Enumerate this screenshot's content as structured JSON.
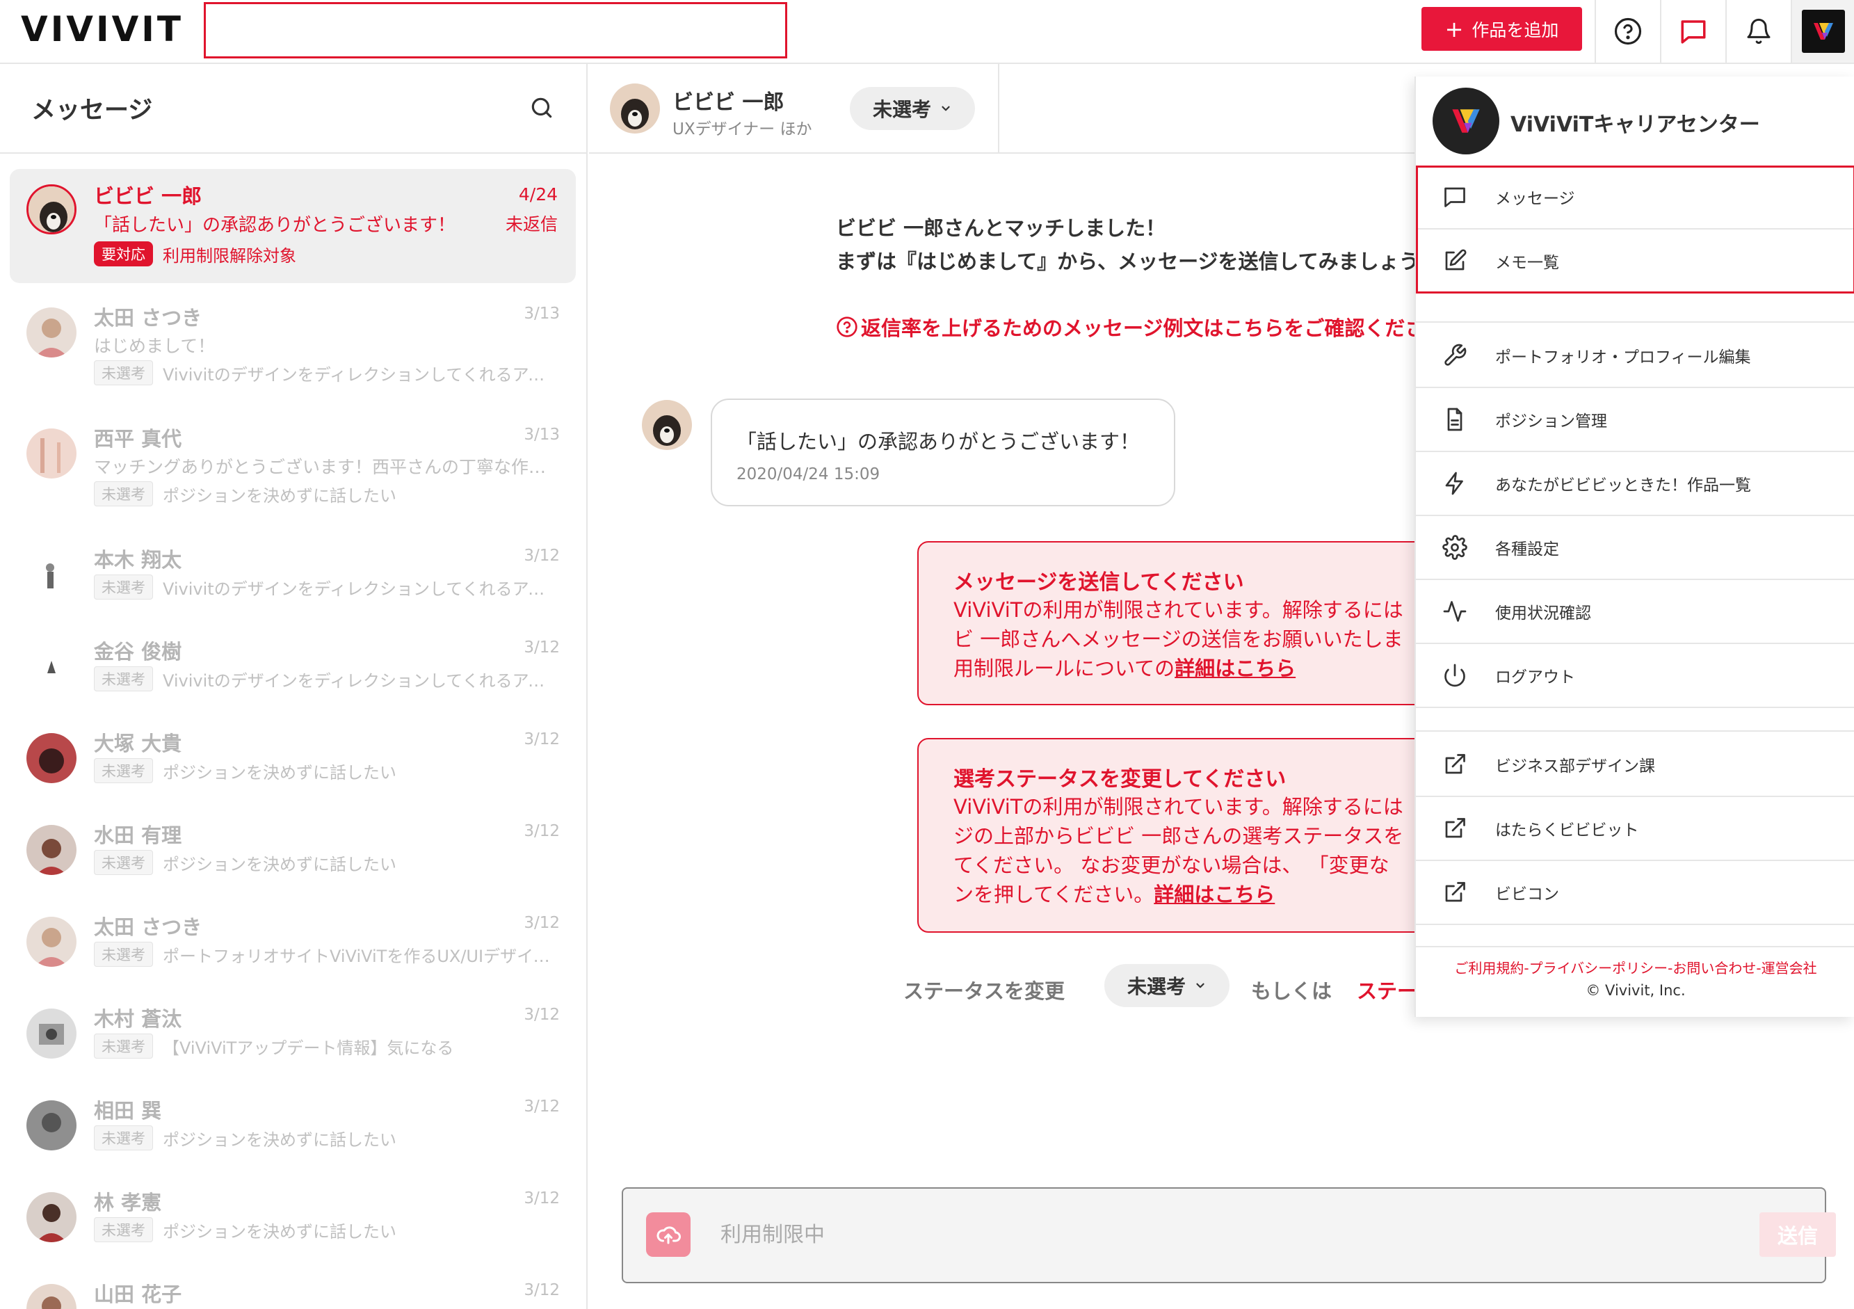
{
  "header": {
    "logo": "VIVIVIT",
    "search_value": "",
    "add_work_label": "作品を追加"
  },
  "sidebar": {
    "title": "メッセージ",
    "conversations": [
      {
        "name": "ビビビ 一郎",
        "date": "4/24",
        "message": "「話したい」の承認ありがとうございます！",
        "status": "未返信",
        "tag": "要対応",
        "desc": "利用制限解除対象"
      },
      {
        "name": "太田 さつき",
        "date": "3/13",
        "message": "はじめまして！",
        "tag": "未選考",
        "desc": "Vivivitのデザインをディレクションしてくれるアートディレクター"
      },
      {
        "name": "西平 真代",
        "date": "3/13",
        "message": "マッチングありがとうございます！西平さんの丁寧な作品に惹かれてご連絡しました",
        "tag": "未選考",
        "desc": "ポジションを決めずに話したい"
      },
      {
        "name": "本木 翔太",
        "date": "3/12",
        "tag": "未選考",
        "desc": "Vivivitのデザインをディレクションしてくれるアートディレクター"
      },
      {
        "name": "金谷 俊樹",
        "date": "3/12",
        "tag": "未選考",
        "desc": "Vivivitのデザインをディレクションしてくれるアートディレクター"
      },
      {
        "name": "大塚 大貴",
        "date": "3/12",
        "tag": "未選考",
        "desc": "ポジションを決めずに話したい"
      },
      {
        "name": "水田 有理",
        "date": "3/12",
        "tag": "未選考",
        "desc": "ポジションを決めずに話したい"
      },
      {
        "name": "太田 さつき",
        "date": "3/12",
        "tag": "未選考",
        "desc": "ポートフォリオサイトViViViTを作るUX/UIデザイナー募集"
      },
      {
        "name": "木村 蒼汰",
        "date": "3/12",
        "tag": "未選考",
        "desc": "【ViViViTアップデート情報】気になる"
      },
      {
        "name": "相田 巽",
        "date": "3/12",
        "tag": "未選考",
        "desc": "ポジションを決めずに話したい"
      },
      {
        "name": "林 孝憲",
        "date": "3/12",
        "tag": "未選考",
        "desc": "ポジションを決めずに話したい"
      },
      {
        "name": "山田 花子",
        "date": "3/12"
      }
    ]
  },
  "chat": {
    "name": "ビビビ 一郎",
    "role": "UXデザイナー ほか",
    "status": "未選考",
    "match_line1": "ビビビ 一郎さんとマッチしました！",
    "match_line2": "まずは『はじめまして』から、メッセージを送信してみましょう",
    "tips_link": "返信率を上げるためのメッセージ例文はこちらをご確認ください",
    "bubble_text": "「話したい」の承認ありがとうございます！",
    "bubble_time": "2020/04/24 15:09",
    "warning1": {
      "title": "メッセージを送信してください",
      "line1": "ViViViTの利用が制限されています。解除するには",
      "line2": "ビ 一郎さんへメッセージの送信をお願いいたしま",
      "line3_prefix": "用制限ルールについての",
      "link": "詳細はこちら"
    },
    "warning2": {
      "title": "選考ステータスを変更してください",
      "line1": "ViViViTの利用が制限されています。解除するには",
      "line2": "ジの上部からビビビ 一郎さんの選考ステータスを",
      "line3": "てください。 なお変更がない場合は、 「変更な",
      "line4_prefix": "ンを押してください。",
      "link": "詳細はこちら"
    },
    "status_change_label": "ステータスを変更",
    "status_change_value": "未選考",
    "or_label": "もしくは",
    "status_link": "ステータスを変更しない",
    "input_placeholder": "利用制限中",
    "send_label": "送信"
  },
  "dropdown": {
    "org_name": "ViViViTキャリアセンター",
    "items": [
      {
        "label": "メッセージ",
        "icon": "chat-icon"
      },
      {
        "label": "メモ一覧",
        "icon": "edit-icon"
      },
      {
        "label": "ポートフォリオ・プロフィール編集",
        "icon": "wrench-icon"
      },
      {
        "label": "ポジション管理",
        "icon": "document-icon"
      },
      {
        "label": "あなたがビビビッときた！作品一覧",
        "icon": "lightning-icon"
      },
      {
        "label": "各種設定",
        "icon": "gear-icon"
      },
      {
        "label": "使用状況確認",
        "icon": "activity-icon"
      },
      {
        "label": "ログアウト",
        "icon": "power-icon"
      },
      {
        "label": "ビジネス部デザイン課",
        "icon": "external-link-icon"
      },
      {
        "label": "はたらくビビビット",
        "icon": "external-link-icon"
      },
      {
        "label": "ビビコン",
        "icon": "external-link-icon"
      }
    ],
    "footer_links": "ご利用規約-プライバシーポリシー-お問い合わせ-運営会社",
    "copyright": "© Vivivit, Inc."
  },
  "colors": {
    "accent": "#e8173a",
    "warning_bg": "#fce9ea",
    "text": "#333333",
    "muted": "#c0c0c0"
  }
}
